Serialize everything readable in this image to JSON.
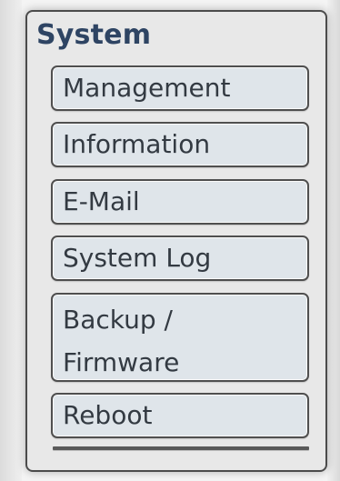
{
  "panel": {
    "title": "System",
    "items": [
      {
        "label": "Management"
      },
      {
        "label": "Information"
      },
      {
        "label": "E-Mail"
      },
      {
        "label": "System Log"
      },
      {
        "label": "Backup / Firmware"
      },
      {
        "label": "Reboot"
      }
    ]
  }
}
